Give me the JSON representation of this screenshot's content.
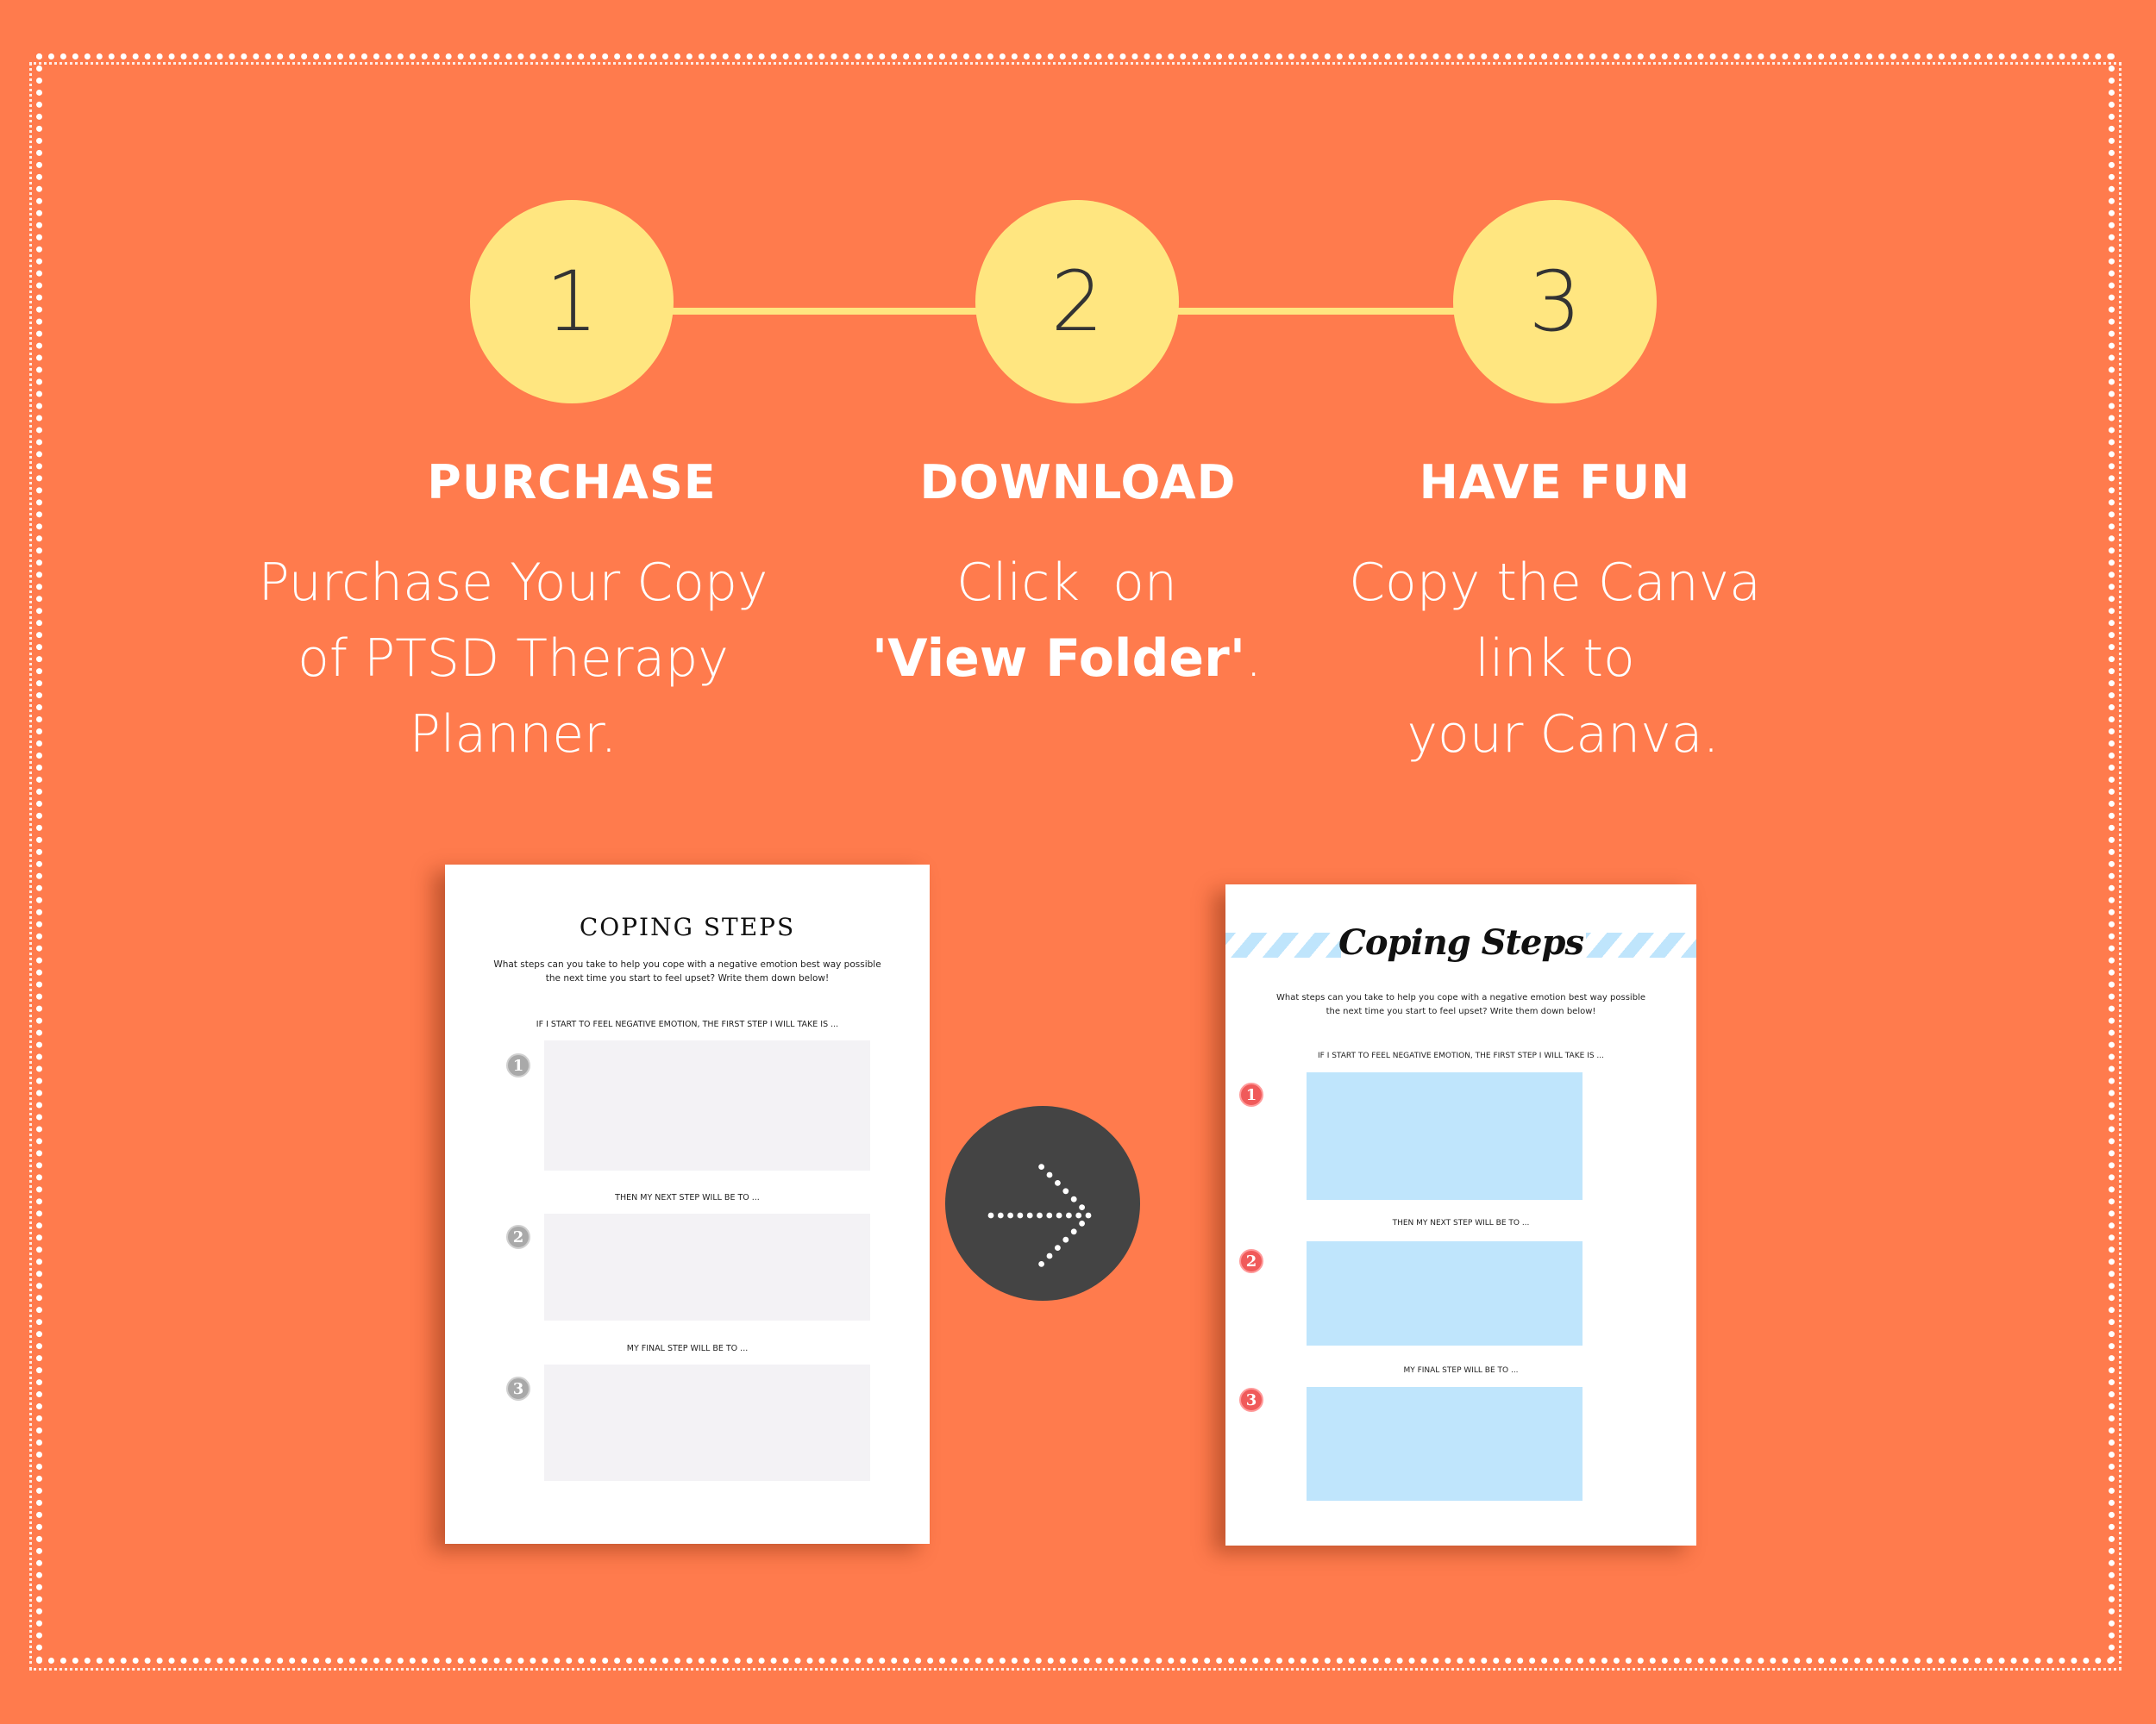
{
  "colors": {
    "background": "#FF7B4D",
    "step_circle": "#FFE680",
    "step_number": "#333333",
    "text": "#FFFFFF",
    "arrow_button": "#444444",
    "left_card_box": "#F3F2F5",
    "right_card_box": "#BFE5FC",
    "right_card_badge": "#F05A5A"
  },
  "steps": [
    {
      "number": "1",
      "title": "PURCHASE",
      "lines": [
        "Purchase Your Copy",
        "of PTSD Therapy",
        "Planner."
      ]
    },
    {
      "number": "2",
      "title": "DOWNLOAD",
      "line1": "Click  on",
      "bold": "'View Folder'",
      "suffix": "."
    },
    {
      "number": "3",
      "title": "HAVE FUN",
      "lines": [
        "Copy the Canva",
        "link to",
        " your Canva."
      ]
    }
  ],
  "arrow": {
    "icon": "dotted-right-arrow-icon"
  },
  "card_before": {
    "title": "COPING STEPS",
    "description": [
      "What steps can you take to help you cope with a negative emotion best way possible",
      "the next time you start to feel upset? Write them down below!"
    ],
    "prompts": [
      {
        "badge": "1",
        "label": "IF I START TO FEEL NEGATIVE EMOTION, THE FIRST STEP I WILL TAKE IS ..."
      },
      {
        "badge": "2",
        "label": "THEN MY NEXT STEP WILL BE TO ..."
      },
      {
        "badge": "3",
        "label": "MY FINAL STEP WILL BE TO ..."
      }
    ]
  },
  "card_after": {
    "title": "Coping Steps",
    "description": [
      "What steps can you take to help you cope with a negative emotion best way possible",
      "the next time you start to feel upset? Write them down below!"
    ],
    "prompts": [
      {
        "badge": "1",
        "label": "IF I START TO FEEL NEGATIVE EMOTION, THE FIRST STEP I WILL TAKE IS ..."
      },
      {
        "badge": "2",
        "label": "THEN MY NEXT STEP WILL BE TO ..."
      },
      {
        "badge": "3",
        "label": "MY FINAL STEP WILL BE TO ..."
      }
    ]
  }
}
